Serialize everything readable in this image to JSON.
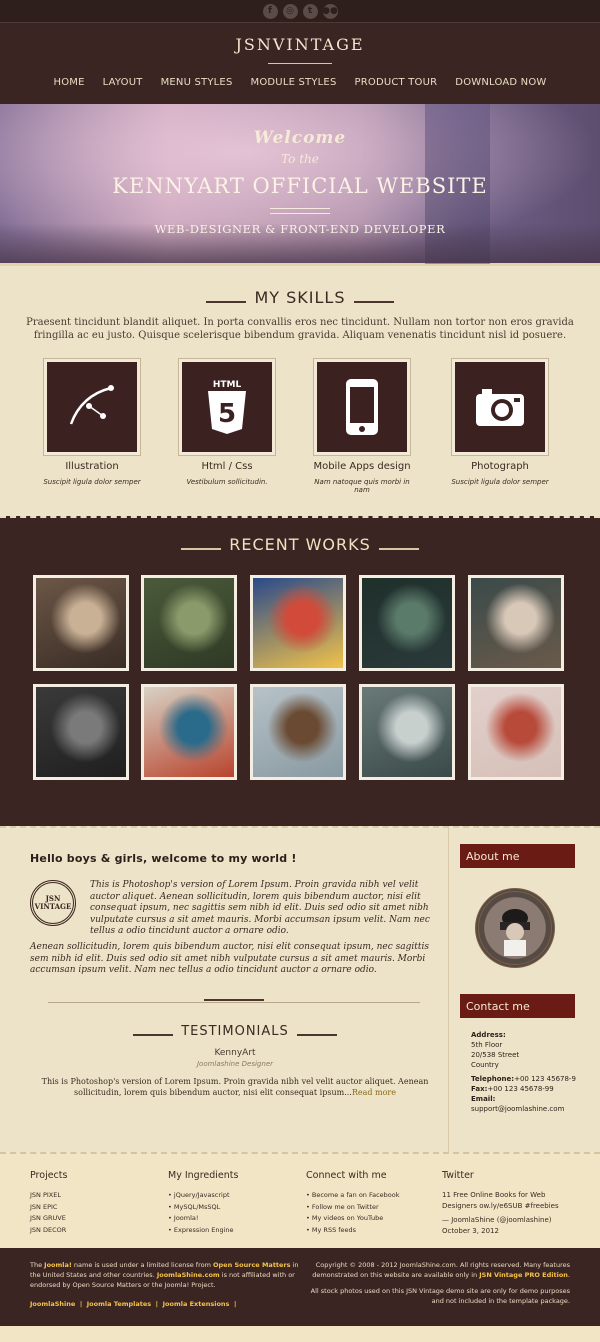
{
  "social": [
    {
      "icon": "facebook-icon",
      "glyph": "f"
    },
    {
      "icon": "dribbble-icon",
      "glyph": "◎"
    },
    {
      "icon": "twitter-icon",
      "glyph": "t"
    },
    {
      "icon": "flickr-icon",
      "glyph": "●●"
    }
  ],
  "header": {
    "logo": "JSNVINTAGE"
  },
  "nav": [
    "HOME",
    "LAYOUT",
    "MENU STYLES",
    "MODULE STYLES",
    "PRODUCT TOUR",
    "DOWNLOAD NOW"
  ],
  "hero": {
    "welcome": "Welcome",
    "to_the": "To the",
    "title": "KENNYART OFFICIAL WEBSITE",
    "subtitle": "WEB-DESIGNER & FRONT-END DEVELOPER"
  },
  "skills": {
    "title": "MY SKILLS",
    "intro": "Praesent tincidunt blandit aliquet. In porta convallis eros nec tincidunt. Nullam non tortor non eros gravida fringilla ac eu justo. Quisque scelerisque bibendum gravida. Aliquam venenatis tincidunt nisl id posuere.",
    "items": [
      {
        "name": "Illustration",
        "desc": "Suscipit ligula dolor semper",
        "icon": "bezier-pen-icon"
      },
      {
        "name": "Html / Css",
        "desc": "Vestibulum sollicitudin.",
        "icon": "html5-icon"
      },
      {
        "name": "Mobile Apps design",
        "desc": "Nam natoque quis morbi in nam",
        "icon": "smartphone-icon"
      },
      {
        "name": "Photograph",
        "desc": "Suscipit ligula dolor semper",
        "icon": "camera-icon"
      }
    ]
  },
  "works": {
    "title": "RECENT WORKS",
    "thumbs": [
      {
        "name": "work-thumb-vintage-camera-hands",
        "colors": [
          "#6c5647",
          "#c9b195",
          "#3a2d25"
        ]
      },
      {
        "name": "work-thumb-lawnmower-grass",
        "colors": [
          "#4a5a3a",
          "#8a9a6a",
          "#2f3a25"
        ]
      },
      {
        "name": "work-thumb-rocking-city-poster",
        "colors": [
          "#2a4a8a",
          "#d24a3a",
          "#f1c24a"
        ]
      },
      {
        "name": "work-thumb-night-street-crowd",
        "colors": [
          "#1f2f2a",
          "#5a7a6a",
          "#2a3a3a"
        ]
      },
      {
        "name": "work-thumb-cafe-umbrella",
        "colors": [
          "#3a4a4a",
          "#d8c8b8",
          "#6a5a4a"
        ]
      },
      {
        "name": "work-thumb-vw-beetle-garage",
        "colors": [
          "#3a3a3a",
          "#7a7a7a",
          "#1f1f1f"
        ]
      },
      {
        "name": "work-thumb-old-books",
        "colors": [
          "#d8d2c4",
          "#2a6a8a",
          "#b8442e"
        ]
      },
      {
        "name": "work-thumb-hooded-person",
        "colors": [
          "#b7c2c8",
          "#6a4a32",
          "#8a9aa2"
        ]
      },
      {
        "name": "work-thumb-vintage-van",
        "colors": [
          "#6a7a78",
          "#c8d0ce",
          "#3a4a4a"
        ]
      },
      {
        "name": "work-thumb-retro-camera-table",
        "colors": [
          "#e2d0cc",
          "#b84a3a",
          "#d6c0b8"
        ]
      }
    ]
  },
  "main": {
    "heading": "Hello boys & girls, welcome to my world !",
    "stamp": "JSN VINTAGE",
    "para1": "This is Photoshop's version of Lorem Ipsum. Proin gravida nibh vel velit auctor aliquet. Aenean sollicitudin, lorem quis bibendum auctor, nisi elit consequat ipsum, nec sagittis sem nibh id elit. Duis sed odio sit amet nibh vulputate cursus a sit amet mauris. Morbi accumsan ipsum velit. Nam nec tellus a odio tincidunt auctor a ornare odio.",
    "para2": "Aenean sollicitudin, lorem quis bibendum auctor, nisi elit consequat ipsum, nec sagittis sem nibh id elit. Duis sed odio sit amet nibh vulputate cursus a sit amet mauris. Morbi accumsan ipsum velit. Nam nec tellus a odio tincidunt auctor a ornare odio.",
    "testimonials_title": "TESTIMONIALS",
    "testimonial_name": "KennyArt",
    "testimonial_role": "Joomlashine Designer",
    "testimonial_text": "This is Photoshop's version of Lorem Ipsum. Proin gravida nibh vel velit auctor aliquet. Aenean sollicitudin, lorem quis bibendum auctor, nisi elit consequat ipsum...",
    "read_more": "Read more"
  },
  "sidebar": {
    "about_title": "About me",
    "contact_title": "Contact me",
    "address_label": "Address:",
    "address_lines": [
      "5th Floor",
      "20/538 Street",
      "Country"
    ],
    "telephone_label": "Telephone:",
    "telephone": "+00 123 45678-9",
    "fax_label": "Fax:",
    "fax": "+00 123 45678-99",
    "email_label": "Email:",
    "email": "support@joomlashine.com"
  },
  "footer_links": {
    "projects": {
      "title": "Projects",
      "items": [
        "JSN PIXEL",
        "JSN EPIC",
        "JSN GRUVE",
        "JSN DECOR"
      ]
    },
    "ingredients": {
      "title": "My Ingredients",
      "items": [
        "• jQuery/Javascript",
        "• MySQL/MsSQL",
        "• Joomla!",
        "• Expression Engine"
      ]
    },
    "connect": {
      "title": "Connect with me",
      "items": [
        "• Become a fan on Facebook",
        "• Follow me on Twitter",
        "• My videos on YouTube",
        "• My RSS feeds"
      ]
    },
    "twitter": {
      "title": "Twitter",
      "text": "11 Free Online Books for Web Designers ow.ly/e6SUB #freebies",
      "author": "— JoomlaShine (@joomlashine)",
      "date": "October 3, 2012"
    }
  },
  "bottom": {
    "left_1": "The ",
    "joomla": "Joomla!",
    "left_2": " name is used under a limited license from ",
    "osm": "Open Source Matters",
    "left_3": " in the United States and other countries. ",
    "jsncom": "JoomlaShine.com",
    "left_4": " is not affiliated with or endorsed by Open Source Matters or the Joomla! Project.",
    "links": [
      "JoomlaShine",
      "Joomla Templates",
      "Joomla Extensions"
    ],
    "right_1": "Copyright © 2008 - 2012 JoomlaShine.com. All rights reserved. Many features demonstrated on this website are available only in ",
    "pro": "JSN Vintage PRO Edition",
    "right_2": ".",
    "right_3": "All stock photos used on this JSN Vintage demo site are only for demo purposes and not included in the template package."
  }
}
